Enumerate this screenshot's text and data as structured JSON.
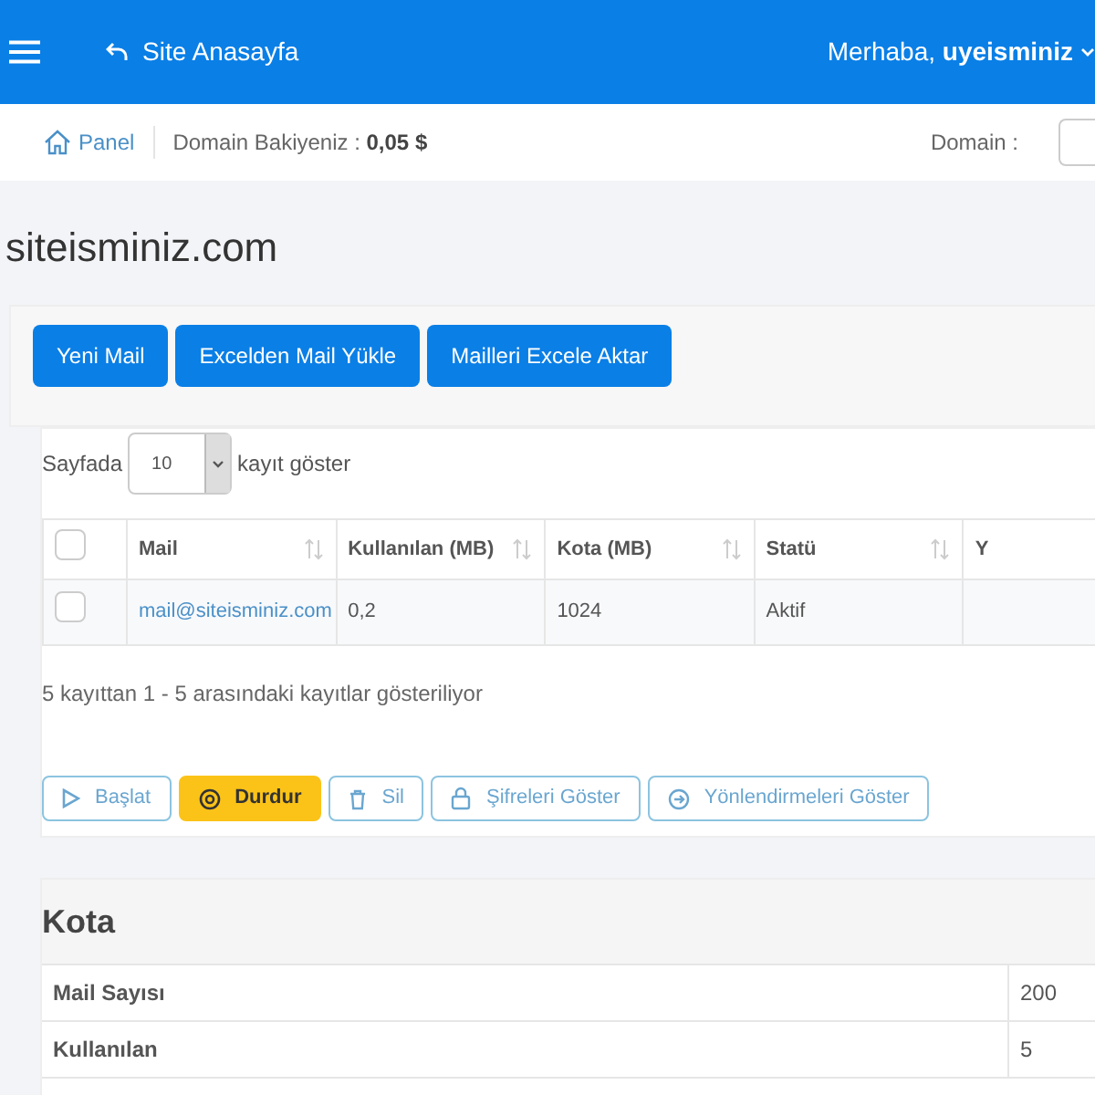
{
  "header": {
    "home_link": "Site Anasayfa",
    "greeting": "Merhaba,",
    "username": "uyeisminiz"
  },
  "breadcrumb": {
    "panel": "Panel",
    "balance_label": "Domain Bakiyeniz :",
    "balance": "0,05 $",
    "domain_label": "Domain :"
  },
  "page_title": "siteisminiz.com",
  "top_buttons": [
    "Yeni Mail",
    "Excelden Mail Yükle",
    "Mailleri Excele Aktar"
  ],
  "length": {
    "prefix": "Sayfada",
    "value": "10",
    "suffix": "kayıt göster"
  },
  "table": {
    "header_checkbox": {
      "checked": false
    },
    "columns": [
      "Mail",
      "Kullanılan (MB)",
      "Kota (MB)",
      "Statü",
      "Y"
    ],
    "rows": [
      {
        "checked": false,
        "cells": [
          "mail@siteisminiz.com",
          "0,2",
          "1024",
          "Aktif"
        ]
      }
    ]
  },
  "info": "5 kayıttan 1 - 5 arasındaki kayıtlar gösteriliyor",
  "actions": [
    {
      "label": "Başlat",
      "kind": "outline"
    },
    {
      "label": "Durdur",
      "kind": "warning"
    },
    {
      "label": "Sil",
      "kind": "outline"
    },
    {
      "label": "Şifreleri Göster",
      "kind": "outline"
    },
    {
      "label": "Yönlendirmeleri Göster",
      "kind": "outline"
    }
  ],
  "quota": {
    "title": "Kota",
    "rows": [
      {
        "label": "Mail Sayısı",
        "value": "200"
      },
      {
        "label": "Kullanılan",
        "value": "5"
      }
    ]
  }
}
